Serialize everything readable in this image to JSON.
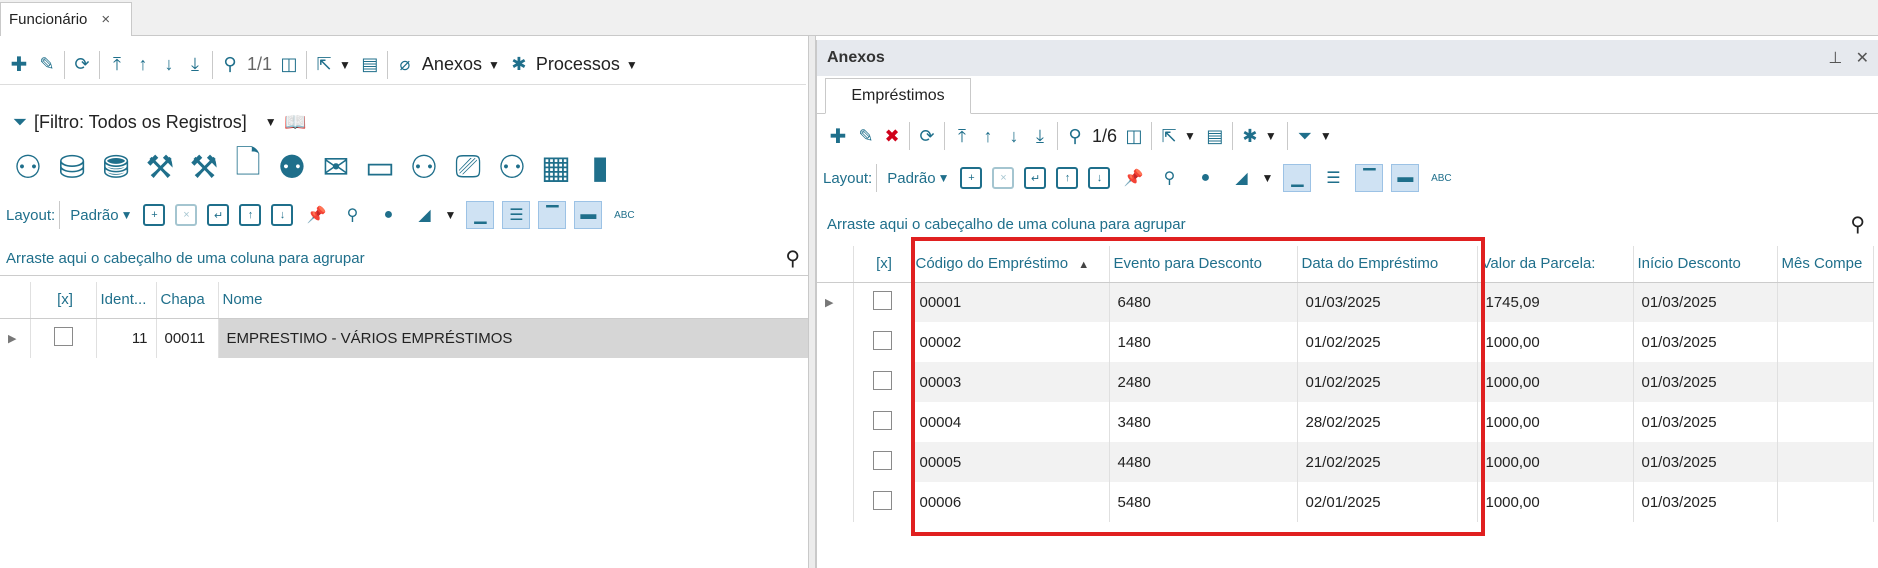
{
  "app_tab": {
    "label": "Funcionário",
    "close": "×"
  },
  "left": {
    "toolbar": {
      "pager": "1/1",
      "anexos": "Anexos",
      "processos": "Processos"
    },
    "filter": "[Filtro: Todos os Registros]",
    "layout_label": "Layout:",
    "layout_value": "Padrão",
    "group_hint": "Arraste aqui o cabeçalho de uma coluna para agrupar",
    "columns": [
      "[x]",
      "Ident...",
      "Chapa",
      "Nome"
    ],
    "rows": [
      {
        "ident": "11",
        "chapa": "00011",
        "nome": "EMPRESTIMO - VÁRIOS EMPRÉSTIMOS"
      }
    ]
  },
  "right": {
    "title": "Anexos",
    "tab": "Empréstimos",
    "pager": "1/6",
    "layout_label": "Layout:",
    "layout_value": "Padrão",
    "group_hint": "Arraste aqui o cabeçalho de uma coluna para agrupar",
    "columns": [
      "[x]",
      "Código do Empréstimo",
      "Evento para Desconto",
      "Data do Empréstimo",
      "Valor da Parcela:",
      "Início Desconto",
      "Mês Compe"
    ],
    "rows": [
      {
        "codigo": "00001",
        "evento": "6480",
        "data": "01/03/2025",
        "valor": "1745,09",
        "inicio": "01/03/2025"
      },
      {
        "codigo": "00002",
        "evento": "1480",
        "data": "01/02/2025",
        "valor": "1000,00",
        "inicio": "01/03/2025"
      },
      {
        "codigo": "00003",
        "evento": "2480",
        "data": "01/02/2025",
        "valor": "1000,00",
        "inicio": "01/03/2025"
      },
      {
        "codigo": "00004",
        "evento": "3480",
        "data": "28/02/2025",
        "valor": "1000,00",
        "inicio": "01/03/2025"
      },
      {
        "codigo": "00005",
        "evento": "4480",
        "data": "21/02/2025",
        "valor": "1000,00",
        "inicio": "01/03/2025"
      },
      {
        "codigo": "00006",
        "evento": "5480",
        "data": "02/01/2025",
        "valor": "1000,00",
        "inicio": "01/03/2025"
      }
    ]
  },
  "colors": {
    "accent": "#1f6f8b",
    "highlight": "#e02020",
    "delete": "#d0021b"
  }
}
